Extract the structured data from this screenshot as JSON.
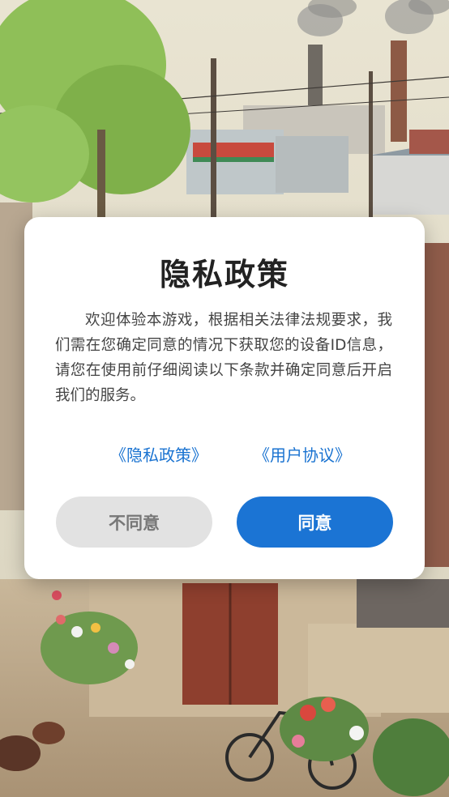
{
  "dialog": {
    "title": "隐私政策",
    "body": "欢迎体验本游戏，根据相关法律法规要求，我们需在您确定同意的情况下获取您的设备ID信息，请您在使用前仔细阅读以下条款并确定同意后开启我们的服务。",
    "links": {
      "privacy": "《隐私政策》",
      "agreement": "《用户协议》"
    },
    "buttons": {
      "disagree": "不同意",
      "agree": "同意"
    }
  },
  "colors": {
    "accent": "#1b74d4",
    "link": "#1a73d1",
    "disagree_bg": "#e2e2e2"
  }
}
